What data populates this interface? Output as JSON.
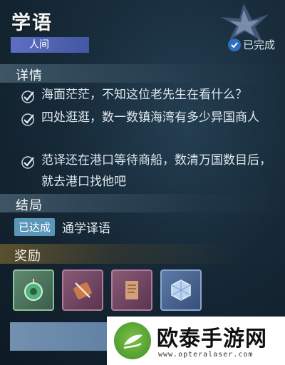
{
  "quest": {
    "title": "学语",
    "category": "人间",
    "status": "已完成"
  },
  "details": {
    "header": "详情",
    "tasks": [
      {
        "text": "海面茫茫，不知这位老先生在看什么？",
        "done": true
      },
      {
        "text": "四处逛逛，数一数镇海湾有多少异国商人",
        "done": true
      },
      {
        "text": "范译还在港口等待商船，数清万国数目后，就去港口找他吧",
        "done": true
      }
    ]
  },
  "outcome": {
    "header": "结局",
    "badge": "已达成",
    "text": "通学译语"
  },
  "rewards": {
    "header": "奖励",
    "items": [
      {
        "icon": "jade-pendant-icon"
      },
      {
        "icon": "bundle-item-icon"
      },
      {
        "icon": "scroll-paper-icon"
      },
      {
        "icon": "crystal-cube-icon"
      }
    ]
  },
  "watermark": {
    "title": "欧泰手游网",
    "url": "www.opteralaser.com"
  },
  "colors": {
    "accent_purple": "#4f63b3",
    "check_blue": "#2f6fbf",
    "badge_blue": "#5b96b9",
    "watermark_green": "#5aa83a"
  }
}
